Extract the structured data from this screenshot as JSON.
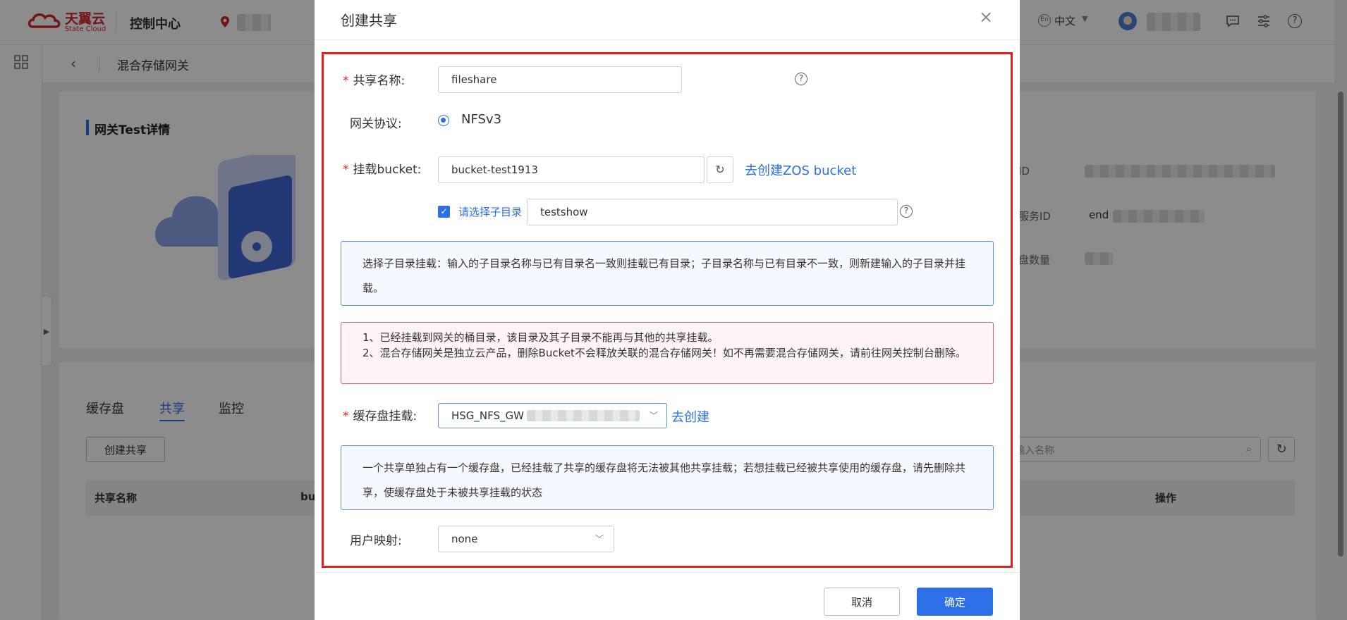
{
  "topbar": {
    "brand_cn": "天翼云",
    "brand_en": "State Cloud",
    "title": "控制中心",
    "lang": "中文",
    "icons": [
      "location-icon",
      "language-icon",
      "avatar",
      "message-icon",
      "settings-icon",
      "help-icon"
    ]
  },
  "breadcrumb": {
    "title": "混合存储网关"
  },
  "detail": {
    "title": "网关Test详情",
    "fields": [
      {
        "label": "ID",
        "value": ""
      },
      {
        "label": "服务ID",
        "value": "end"
      },
      {
        "label": "盘数量",
        "value": ""
      }
    ]
  },
  "tabs": [
    "缓存盘",
    "共享",
    "监控"
  ],
  "active_tab": "共享",
  "create_share_button": "创建共享",
  "search": {
    "placeholder": "输入名称"
  },
  "table": {
    "columns": [
      "共享名称",
      "bu",
      "操作"
    ]
  },
  "modal": {
    "title": "创建共享",
    "share_name": {
      "label": "共享名称:",
      "value": "fileshare"
    },
    "protocol": {
      "label": "网关协议:",
      "option": "NFSv3"
    },
    "bucket": {
      "label": "挂载bucket:",
      "value": "bucket-test1913",
      "link": "去创建ZOS bucket"
    },
    "subdir": {
      "label": "请选择子目录",
      "checked": true,
      "value": "testshow"
    },
    "info1": "选择子目录挂载：输入的子目录名称与已有目录名一致则挂载已有目录；子目录名称与已有目录不一致，则新建输入的子目录并挂载。",
    "warn_lines": [
      "1、已经挂载到网关的桶目录，该目录及其子目录不能再与其他的共享挂载。",
      "2、混合存储网关是独立云产品，删除Bucket不会释放关联的混合存储网关！如不再需要混合存储网关，请前往网关控制台删除。"
    ],
    "cache": {
      "label": "缓存盘挂载:",
      "value": "HSG_NFS_GW",
      "link": "去创建"
    },
    "info2": "一个共享单独占有一个缓存盘，已经挂载了共享的缓存盘将无法被其他共享挂载；若想挂载已经被共享使用的缓存盘，请先删除共享，使缓存盘处于未被共享挂载的状态",
    "user_map": {
      "label": "用户映射:",
      "value": "none"
    },
    "cancel": "取消",
    "confirm": "确定"
  },
  "colors": {
    "primary": "#2d6fe6",
    "danger": "#e62020",
    "brand": "#d4272b"
  }
}
